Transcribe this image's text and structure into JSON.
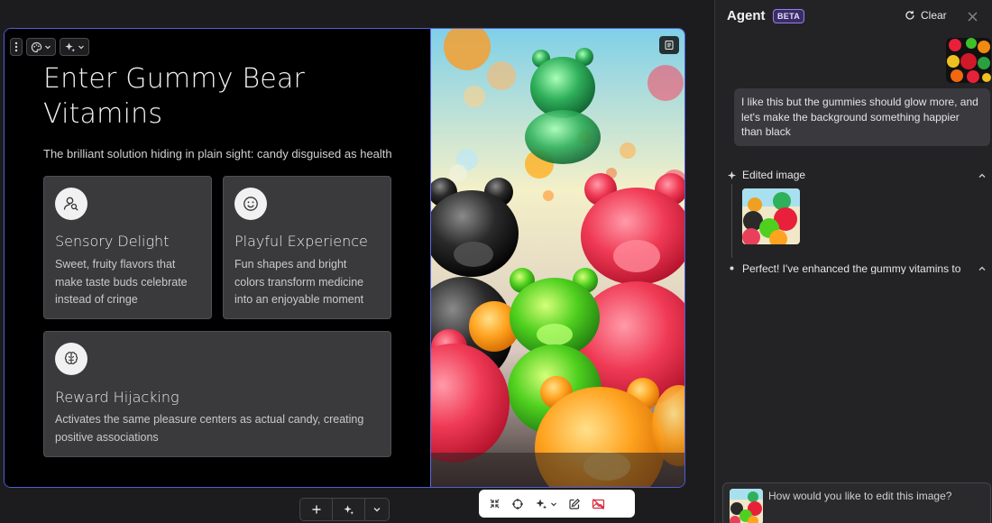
{
  "slide": {
    "title": "Enter Gummy Bear Vitamins",
    "subtitle": "The brilliant solution hiding in plain sight: candy disguised as health",
    "cards": [
      {
        "icon": "person-search-icon",
        "title": "Sensory Delight",
        "text": "Sweet, fruity flavors that make taste buds celebrate instead of cringe"
      },
      {
        "icon": "smiley-face-icon",
        "title": "Playful Experience",
        "text": "Fun shapes and bright colors transform medicine into an enjoyable moment"
      },
      {
        "icon": "brain-icon",
        "title": "Reward Hijacking",
        "text": "Activates the same pleasure centers as actual candy, creating positive associations"
      }
    ]
  },
  "agent": {
    "title": "Agent",
    "badge": "BETA",
    "clear_label": "Clear",
    "user_message": "I like this but the gummies should glow more, and let's make the background something happier than black",
    "step_edited": "Edited image",
    "step_reply": "Perfect! I've enhanced the gummy vitamins to",
    "input_placeholder": "How would you like to edit this image?"
  },
  "colors": {
    "selection_border": "#4f5fd6",
    "beta_badge": "#9b7df0",
    "card_bg": "#3a3a3d"
  }
}
